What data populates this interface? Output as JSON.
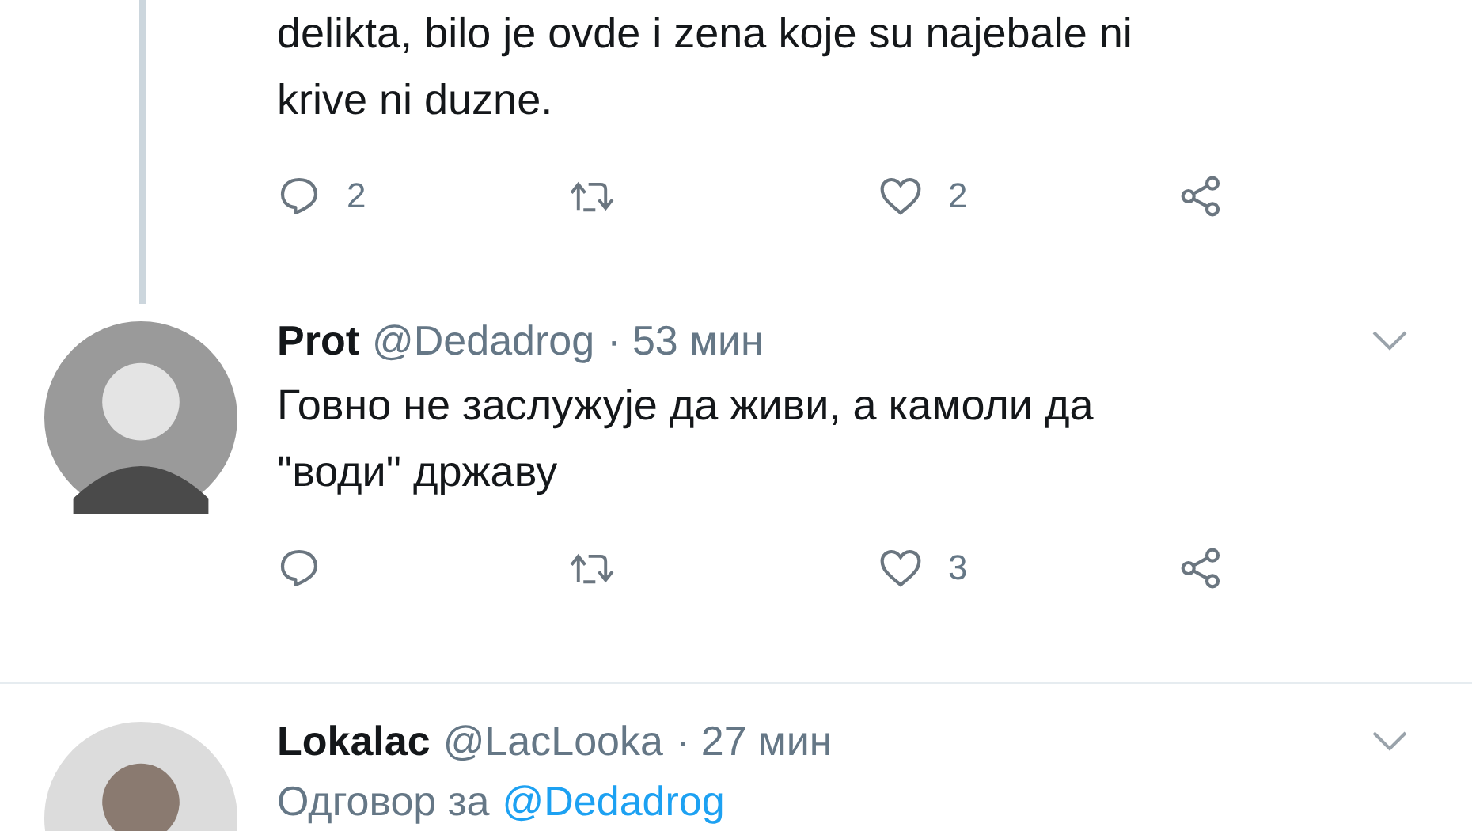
{
  "tweets": [
    {
      "kind": "continuation",
      "lines": [
        "delikta, bilo je ovde i zena koje su najebale ni",
        "krive ni duzne."
      ],
      "replies": "2",
      "likes": "2"
    },
    {
      "kind": "full",
      "name": "Prot",
      "handle": "@Dedadrog",
      "time": "· 53 мин",
      "lines": [
        "Говно не заслужује да живи, а камоли да",
        "\"води\" државу"
      ],
      "likes": "3"
    },
    {
      "kind": "header",
      "name": "Lokalac",
      "handle": "@LacLooka",
      "time": "· 27 мин",
      "reply_label": "Одговор за",
      "reply_to": "@Dedadrog"
    }
  ]
}
